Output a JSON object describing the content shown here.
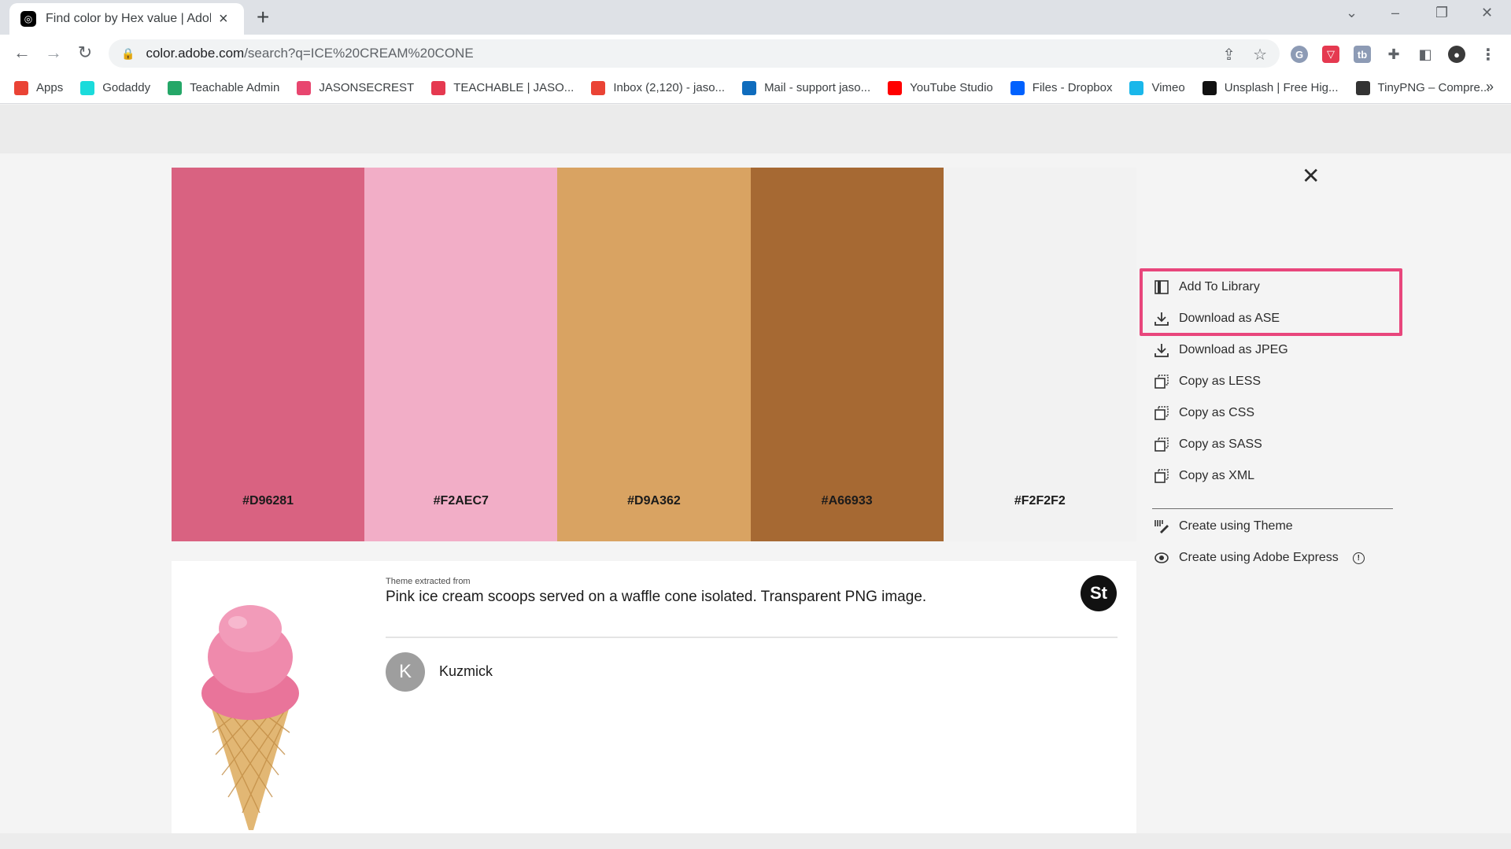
{
  "browser": {
    "tab_title": "Find color by Hex value | Adobe",
    "url_host": "color.adobe.com",
    "url_path": "/search?q=ICE%20CREAM%20CONE"
  },
  "bookmarks": [
    {
      "label": "Apps",
      "icon": "apps-grid-icon",
      "color": "#ea4335"
    },
    {
      "label": "Godaddy",
      "icon": "godaddy-icon",
      "color": "#1bdbdb"
    },
    {
      "label": "Teachable Admin",
      "icon": "teachable-icon",
      "color": "#25a768"
    },
    {
      "label": "JASONSECREST",
      "icon": "site-icon",
      "color": "#e8466f"
    },
    {
      "label": "TEACHABLE | JASO...",
      "icon": "download-icon",
      "color": "#e53950"
    },
    {
      "label": "Inbox (2,120) - jaso...",
      "icon": "gmail-icon",
      "color": "#ea4335"
    },
    {
      "label": "Mail - support jaso...",
      "icon": "outlook-icon",
      "color": "#0f6cbd"
    },
    {
      "label": "YouTube Studio",
      "icon": "youtube-icon",
      "color": "#ff0000"
    },
    {
      "label": "Files - Dropbox",
      "icon": "dropbox-icon",
      "color": "#0061fe"
    },
    {
      "label": "Vimeo",
      "icon": "vimeo-icon",
      "color": "#1ab7ea"
    },
    {
      "label": "Unsplash | Free Hig...",
      "icon": "unsplash-icon",
      "color": "#111111"
    },
    {
      "label": "TinyPNG – Compre...",
      "icon": "tinypng-icon",
      "color": "#333333"
    }
  ],
  "palette": [
    {
      "hex": "#D96281",
      "color": "#D96281"
    },
    {
      "hex": "#F2AEC7",
      "color": "#F2AEC7"
    },
    {
      "hex": "#D9A362",
      "color": "#D9A362"
    },
    {
      "hex": "#A66933",
      "color": "#A66933"
    },
    {
      "hex": "#F2F2F2",
      "color": "#F2F2F2"
    }
  ],
  "theme": {
    "extracted_label": "Theme extracted from",
    "title": "Pink ice cream scoops served on a waffle cone isolated. Transparent PNG image.",
    "badge": "St",
    "author_initial": "K",
    "author": "Kuzmick"
  },
  "menu": {
    "add_to_library": "Add To Library",
    "download_ase": "Download as ASE",
    "download_jpeg": "Download as JPEG",
    "copy_less": "Copy as LESS",
    "copy_css": "Copy as CSS",
    "copy_sass": "Copy as SASS",
    "copy_xml": "Copy as XML",
    "create_theme": "Create using Theme",
    "create_express": "Create using Adobe Express"
  },
  "highlight_color": "#e8467c"
}
